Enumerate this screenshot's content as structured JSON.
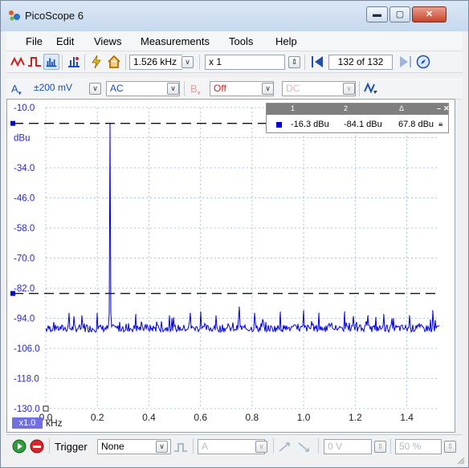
{
  "window": {
    "title": "PicoScope 6"
  },
  "menu": [
    "File",
    "Edit",
    "Views",
    "Measurements",
    "Tools",
    "Help"
  ],
  "toolbar1": {
    "timebase": "1.526 kHz",
    "multiplier": "x 1",
    "capture_index": "132 of 132"
  },
  "toolbar2": {
    "channel_a": "A",
    "range": "±200 mV",
    "coupling": "AC",
    "channel_b": "B",
    "b_state": "Off",
    "b_coupling": "DC"
  },
  "scope": {
    "unit_top": "dBu",
    "unit_x_multiplier": "x1.0",
    "unit_x": "kHz",
    "trace_color": "#0000e0",
    "ruler_1_db": -16.3,
    "ruler_2_db": -84.1
  },
  "chart_data": {
    "type": "line",
    "xlabel": "kHz",
    "ylabel": "dBu",
    "x_ticks": [
      "0.0",
      "0.2",
      "0.4",
      "0.6",
      "0.8",
      "1.0",
      "1.2",
      "1.4"
    ],
    "y_ticks": [
      "-10.0",
      "-22.0",
      "-34.0",
      "-46.0",
      "-58.0",
      "-70.0",
      "-82.0",
      "-94.0",
      "-106.0",
      "-118.0",
      "-130.0"
    ],
    "xlim": [
      0,
      1.526
    ],
    "ylim": [
      -130,
      -10
    ],
    "grid": true,
    "noise_floor_db": -98,
    "peak": {
      "x": 0.25,
      "y": -16.3
    },
    "spurs": [
      {
        "x": 0.09,
        "y": -92
      },
      {
        "x": 0.14,
        "y": -93
      },
      {
        "x": 0.2,
        "y": -92
      },
      {
        "x": 0.35,
        "y": -92.5
      },
      {
        "x": 0.48,
        "y": -93
      },
      {
        "x": 0.56,
        "y": -92
      },
      {
        "x": 0.6,
        "y": -91.5
      },
      {
        "x": 0.66,
        "y": -93
      },
      {
        "x": 0.75,
        "y": -89.5
      },
      {
        "x": 0.81,
        "y": -92
      },
      {
        "x": 0.91,
        "y": -91.5
      },
      {
        "x": 1.0,
        "y": -91
      },
      {
        "x": 1.06,
        "y": -92
      },
      {
        "x": 1.16,
        "y": -91.5
      },
      {
        "x": 1.25,
        "y": -93
      },
      {
        "x": 1.31,
        "y": -92.5
      },
      {
        "x": 1.41,
        "y": -93
      },
      {
        "x": 1.5,
        "y": -91
      }
    ]
  },
  "measurements": {
    "headers": [
      "1",
      "2",
      "Δ"
    ],
    "values": [
      "-16.3 dBu",
      "-84.1 dBu",
      "67.8 dBu"
    ]
  },
  "bottom": {
    "trigger_label": "Trigger",
    "trigger_mode": "None",
    "trigger_source": "A",
    "threshold": "0 V",
    "pretrigger": "50 %"
  }
}
